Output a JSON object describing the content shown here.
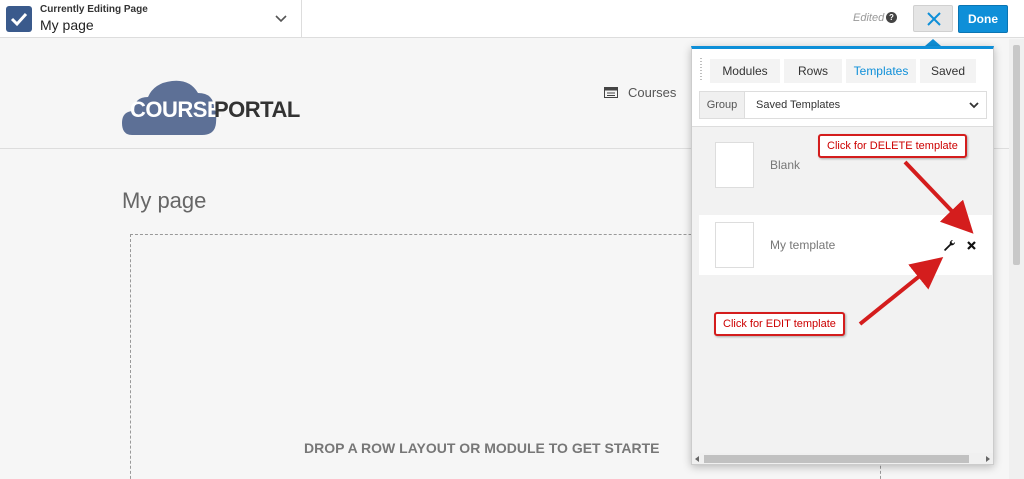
{
  "topbar": {
    "editing_label": "Currently Editing Page",
    "page_name": "My page",
    "edited_label": "Edited",
    "help_glyph": "?",
    "close_icon": "close-icon",
    "done_label": "Done"
  },
  "site": {
    "logo_course": "COURSE",
    "logo_portal": "PORTAL",
    "nav_courses": "Courses"
  },
  "main": {
    "page_title": "My page",
    "drop_text": "DROP A ROW LAYOUT OR MODULE TO GET STARTE"
  },
  "panel": {
    "tabs": [
      {
        "label": "Modules",
        "active": false
      },
      {
        "label": "Rows",
        "active": false
      },
      {
        "label": "Templates",
        "active": true
      },
      {
        "label": "Saved",
        "active": false
      }
    ],
    "group_label": "Group",
    "group_value": "Saved Templates",
    "templates": [
      {
        "name": "Blank"
      },
      {
        "name": "My template"
      }
    ]
  },
  "annotations": {
    "delete_callout": "Click for DELETE template",
    "edit_callout": "Click for EDIT template"
  },
  "colors": {
    "accent": "#0e8fd8",
    "brand": "#5d7096",
    "annotation": "#d41d1d"
  }
}
